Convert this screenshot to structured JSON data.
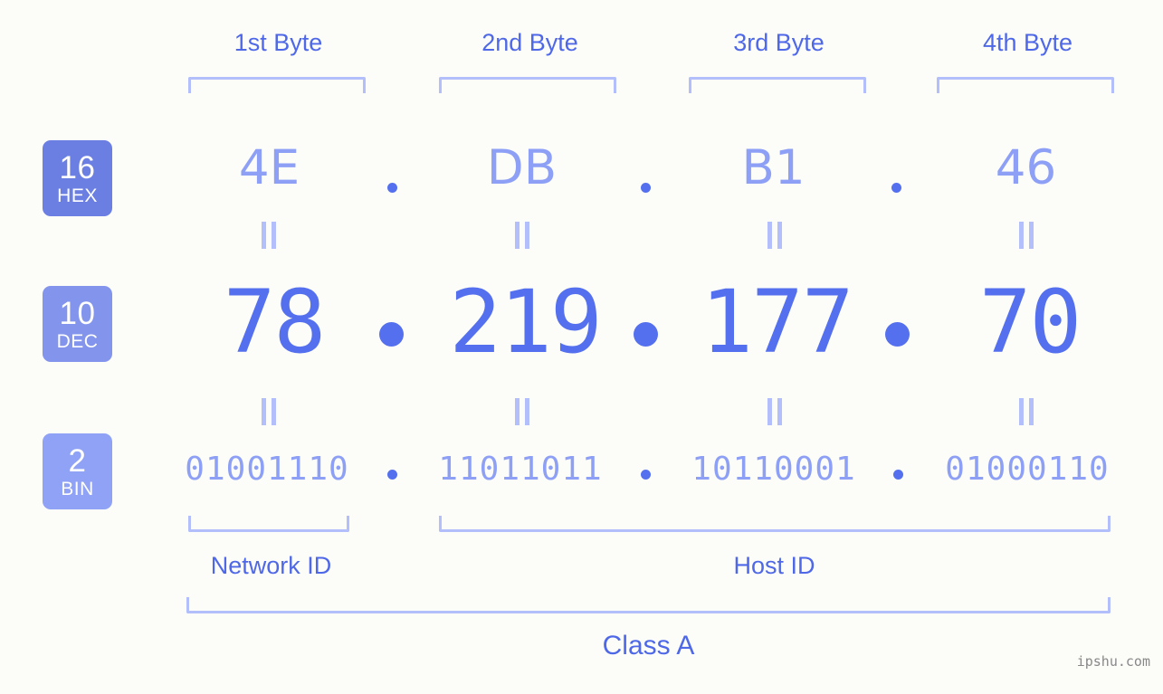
{
  "diagram": {
    "ip_address": "78.219.177.70",
    "byte_headers": [
      {
        "label": "1st Byte"
      },
      {
        "label": "2nd Byte"
      },
      {
        "label": "3rd Byte"
      },
      {
        "label": "4th Byte"
      }
    ],
    "radix_badges": [
      {
        "number": "16",
        "name": "HEX",
        "color": "#6b7fe3"
      },
      {
        "number": "10",
        "name": "DEC",
        "color": "#8294ec"
      },
      {
        "number": "2",
        "name": "BIN",
        "color": "#8fa2f5"
      }
    ],
    "rows": {
      "hex": {
        "octets": [
          "4E",
          "DB",
          "B1",
          "46"
        ],
        "separator": "."
      },
      "dec": {
        "octets": [
          "78",
          "219",
          "177",
          "70"
        ],
        "separator": "."
      },
      "bin": {
        "octets": [
          "01001110",
          "11011011",
          "10110001",
          "01000110"
        ],
        "separator": "."
      }
    },
    "equality_marker": "=",
    "segments": [
      {
        "label": "Network ID"
      },
      {
        "label": "Host ID"
      }
    ],
    "class_label": "Class A",
    "watermark": "ipshu.com",
    "colors": {
      "background": "#fcfdf9",
      "accent_strong": "#5570ee",
      "accent_text": "#4f68e8",
      "accent_light": "#8da0f5",
      "bracket": "#b3bffb"
    }
  }
}
